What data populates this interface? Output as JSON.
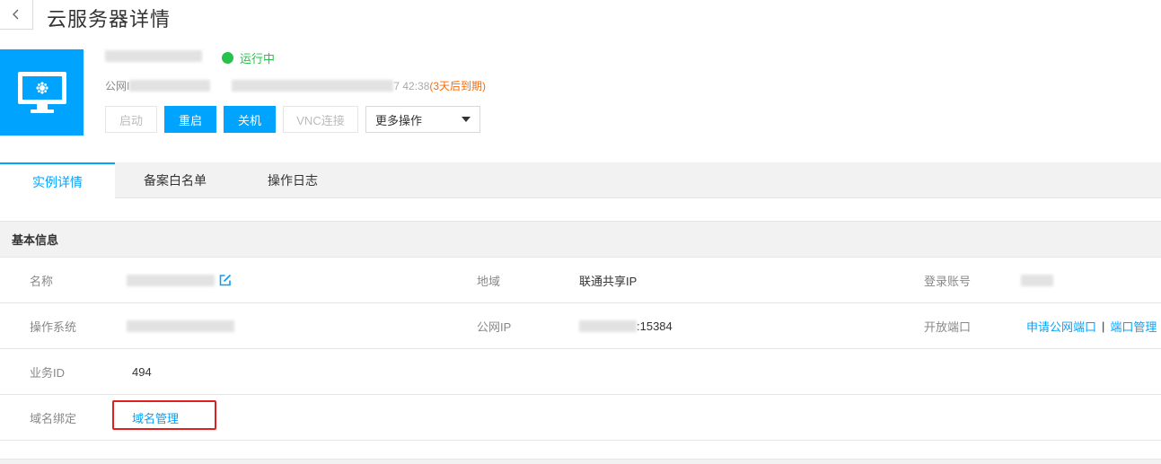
{
  "header": {
    "title": "云服务器详情"
  },
  "instance": {
    "status": "运行中",
    "ip_prefix": "公网I",
    "expire_time": "7 42:38",
    "expire_tag": "(3天后到期)",
    "status_color": "#27c24c",
    "accent_color": "#00a4ff"
  },
  "actions": {
    "start": "启动",
    "restart": "重启",
    "shutdown": "关机",
    "vnc": "VNC连接",
    "more": "更多操作"
  },
  "tabs": [
    {
      "label": "实例详情",
      "active": true
    },
    {
      "label": "备案白名单",
      "active": false
    },
    {
      "label": "操作日志",
      "active": false
    }
  ],
  "section": {
    "title": "基本信息"
  },
  "fields": {
    "name_label": "名称",
    "region_label": "地域",
    "region_value": "联通共享IP",
    "login_label": "登录账号",
    "os_label": "操作系统",
    "public_ip_label": "公网IP",
    "public_ip_suffix": ":15384",
    "ports_label": "开放端口",
    "apply_port_link": "申请公网端口",
    "port_sep": "|",
    "port_manage_link": "端口管理",
    "business_id_label": "业务ID",
    "business_id_value": "494",
    "domain_label": "域名绑定",
    "domain_manage_link": "域名管理"
  }
}
